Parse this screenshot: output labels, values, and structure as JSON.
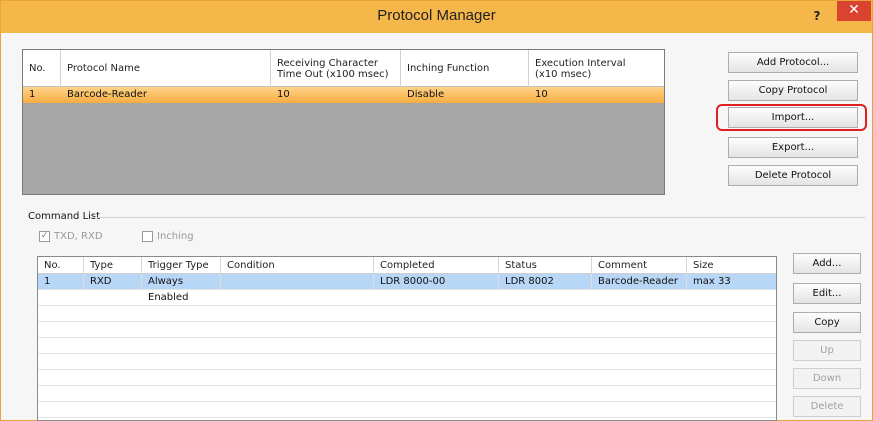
{
  "window": {
    "title": "Protocol Manager",
    "help_label": "?",
    "close_label": "✕",
    "accent_color": "#f5b74a"
  },
  "protocol_table": {
    "headers": [
      "No.",
      "Protocol Name",
      "Receiving Character\nTime Out (x100 msec)",
      "Inching Function",
      "Execution Interval\n(x10 msec)"
    ],
    "rows": [
      [
        "1",
        "Barcode-Reader",
        "10",
        "Disable",
        "10"
      ]
    ]
  },
  "protocol_buttons": {
    "add": "Add Protocol...",
    "copy": "Copy Protocol",
    "import": "Import...",
    "export": "Export...",
    "delete": "Delete Protocol"
  },
  "command_list": {
    "label": "Command List",
    "checkbox_txd_rxd": "TXD, RXD",
    "checkbox_inching": "Inching",
    "headers": [
      "No.",
      "Type",
      "Trigger Type",
      "Condition",
      "Completed",
      "Status",
      "Comment",
      "Size"
    ],
    "rows": [
      [
        "1",
        "RXD",
        "Always Enabled",
        "",
        "LDR 8000-00",
        "LDR 8002",
        "Barcode-Reader",
        "max 33"
      ]
    ]
  },
  "command_buttons": {
    "add": "Add...",
    "edit": "Edit...",
    "copy": "Copy",
    "up": "Up",
    "down": "Down",
    "delete": "Delete"
  }
}
